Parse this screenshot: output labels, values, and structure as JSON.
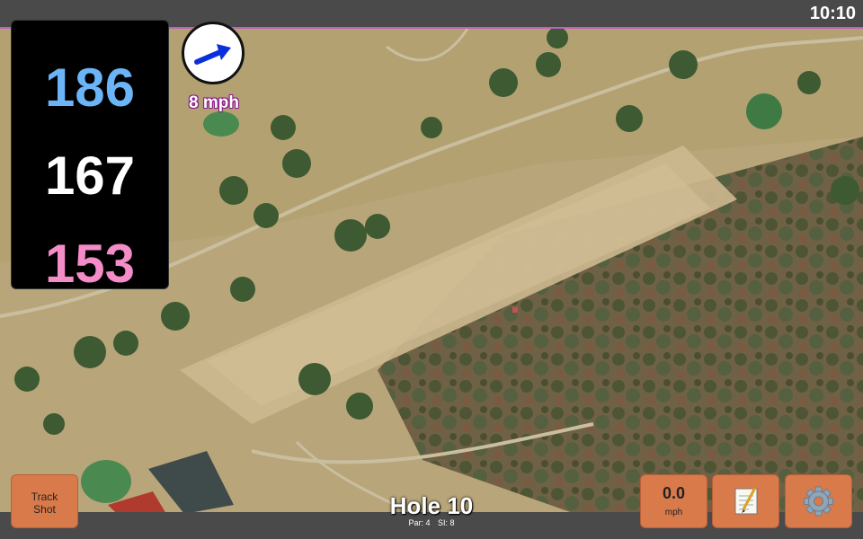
{
  "status": {
    "time": "10:10"
  },
  "distances": {
    "back": "186",
    "middle": "167",
    "front": "153"
  },
  "wind": {
    "speed": "8 mph"
  },
  "buttons": {
    "track_shot_line1": "Track",
    "track_shot_line2": "Shot",
    "speed_value": "0.0",
    "speed_unit": "mph"
  },
  "hole": {
    "title": "Hole 10",
    "par": "Par: 4",
    "si": "SI: 8"
  },
  "icons": {
    "notes": "notepad-icon",
    "settings": "gear-icon",
    "wind": "wind-direction-arrow-icon"
  },
  "colors": {
    "back": "#6cb4f8",
    "middle": "#ffffff",
    "front": "#f48cc8",
    "button": "#d97a4a"
  }
}
